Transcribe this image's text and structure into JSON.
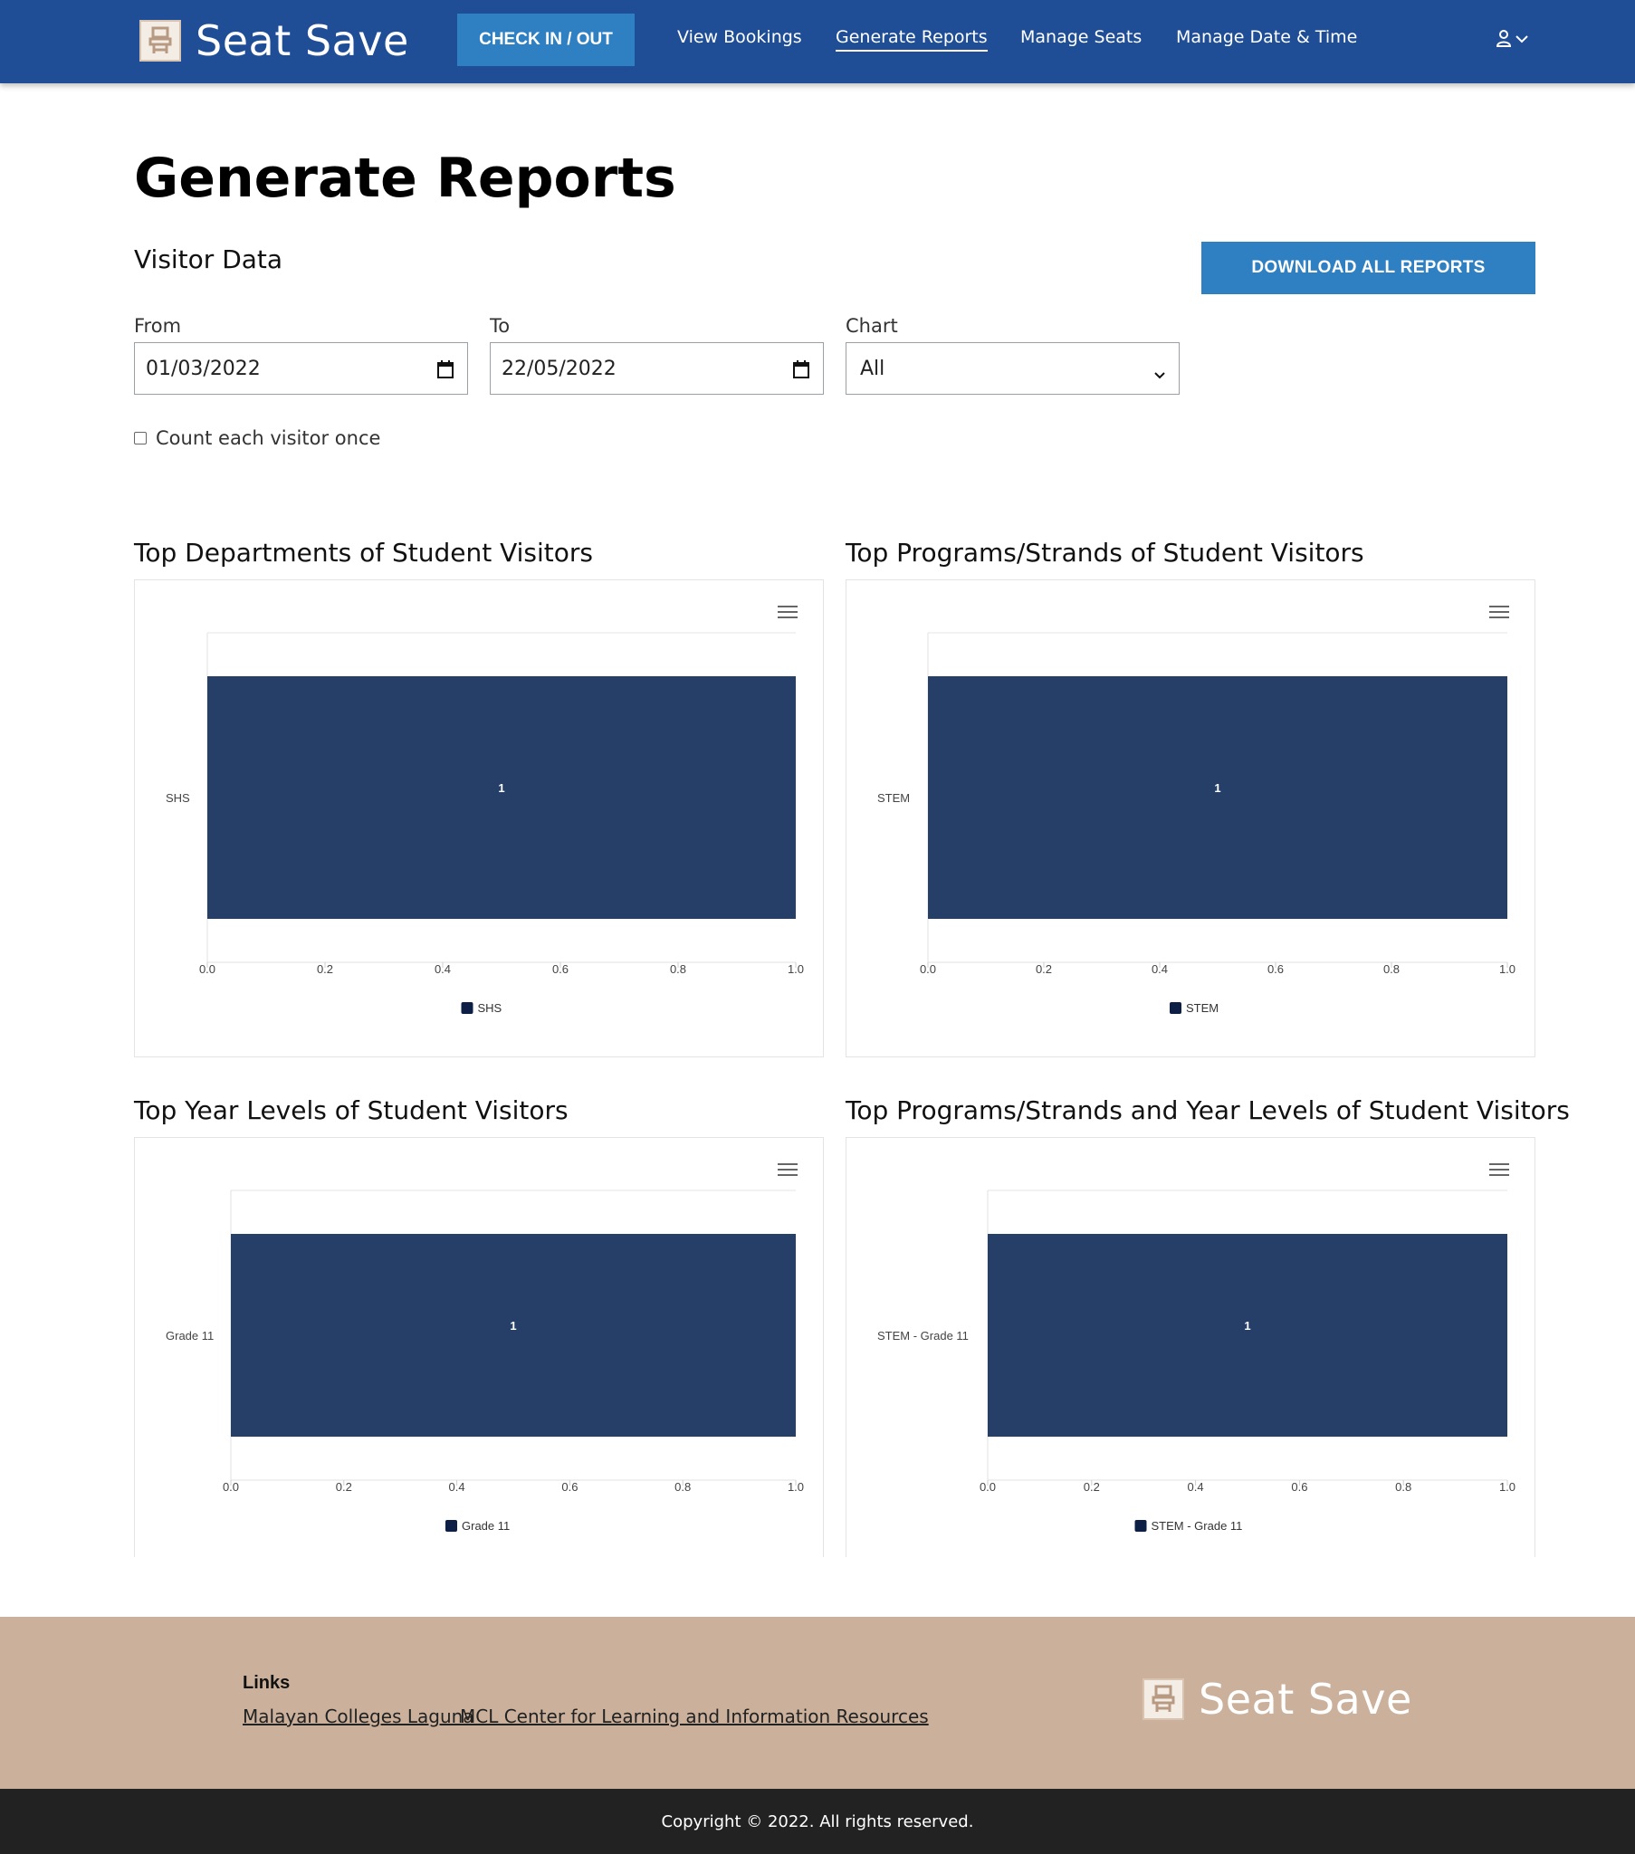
{
  "header": {
    "logo_text": "Seat Save",
    "checkin_label": "CHECK IN / OUT",
    "nav": [
      "View Bookings",
      "Generate Reports",
      "Manage Seats",
      "Manage Date & Time"
    ],
    "active_nav": "Generate Reports"
  },
  "page": {
    "title": "Generate Reports",
    "section_title": "Visitor Data",
    "download_label": "DOWNLOAD ALL REPORTS",
    "filters": {
      "from_label": "From",
      "from_value": "01/03/2022",
      "to_label": "To",
      "to_value": "22/05/2022",
      "chart_label": "Chart",
      "chart_value": "All"
    },
    "checkbox_label": "Count each visitor once"
  },
  "charts": [
    {
      "title": "Top Departments of Student Visitors"
    },
    {
      "title": "Top Programs/Strands of Student Visitors"
    },
    {
      "title": "Top Year Levels of Student Visitors"
    },
    {
      "title": "Top Programs/Strands and Year Levels of Student Visitors"
    }
  ],
  "chart_data": [
    {
      "type": "bar",
      "orientation": "horizontal",
      "categories": [
        "SHS"
      ],
      "series": [
        {
          "name": "SHS",
          "values": [
            1
          ]
        }
      ],
      "xlim": [
        0,
        1.0
      ],
      "xticks": [
        "0.0",
        "0.2",
        "0.4",
        "0.6",
        "0.8",
        "1.0"
      ],
      "data_labels": [
        "1"
      ],
      "color": "#263f68",
      "legend_color": "#0e1f45",
      "legend": "bottom"
    },
    {
      "type": "bar",
      "orientation": "horizontal",
      "categories": [
        "STEM"
      ],
      "series": [
        {
          "name": "STEM",
          "values": [
            1
          ]
        }
      ],
      "xlim": [
        0,
        1.0
      ],
      "xticks": [
        "0.0",
        "0.2",
        "0.4",
        "0.6",
        "0.8",
        "1.0"
      ],
      "data_labels": [
        "1"
      ],
      "color": "#263f68",
      "legend_color": "#0e1f45",
      "legend": "bottom"
    },
    {
      "type": "bar",
      "orientation": "horizontal",
      "categories": [
        "Grade 11"
      ],
      "series": [
        {
          "name": "Grade 11",
          "values": [
            1
          ]
        }
      ],
      "xlim": [
        0,
        1.0
      ],
      "xticks": [
        "0.0",
        "0.2",
        "0.4",
        "0.6",
        "0.8",
        "1.0"
      ],
      "data_labels": [
        "1"
      ],
      "color": "#263f68",
      "legend_color": "#0e1f45",
      "legend": "bottom"
    },
    {
      "type": "bar",
      "orientation": "horizontal",
      "categories": [
        "STEM - Grade 11"
      ],
      "series": [
        {
          "name": "STEM - Grade 11",
          "values": [
            1
          ]
        }
      ],
      "xlim": [
        0,
        1.0
      ],
      "xticks": [
        "0.0",
        "0.2",
        "0.4",
        "0.6",
        "0.8",
        "1.0"
      ],
      "data_labels": [
        "1"
      ],
      "color": "#263f68",
      "legend_color": "#0e1f45",
      "legend": "bottom"
    }
  ],
  "footer": {
    "links_title": "Links",
    "links": [
      "Malayan Colleges Laguna",
      "MCL Center for Learning and Information Resources"
    ],
    "logo_text": "Seat Save",
    "copyright": "Copyright © 2022. All rights reserved."
  },
  "colors": {
    "header_bg": "#1f4e96",
    "button_bg": "#2f80c2",
    "bar": "#263f68",
    "footer_bg": "#cbb19c",
    "copyright_bg": "#222222"
  }
}
